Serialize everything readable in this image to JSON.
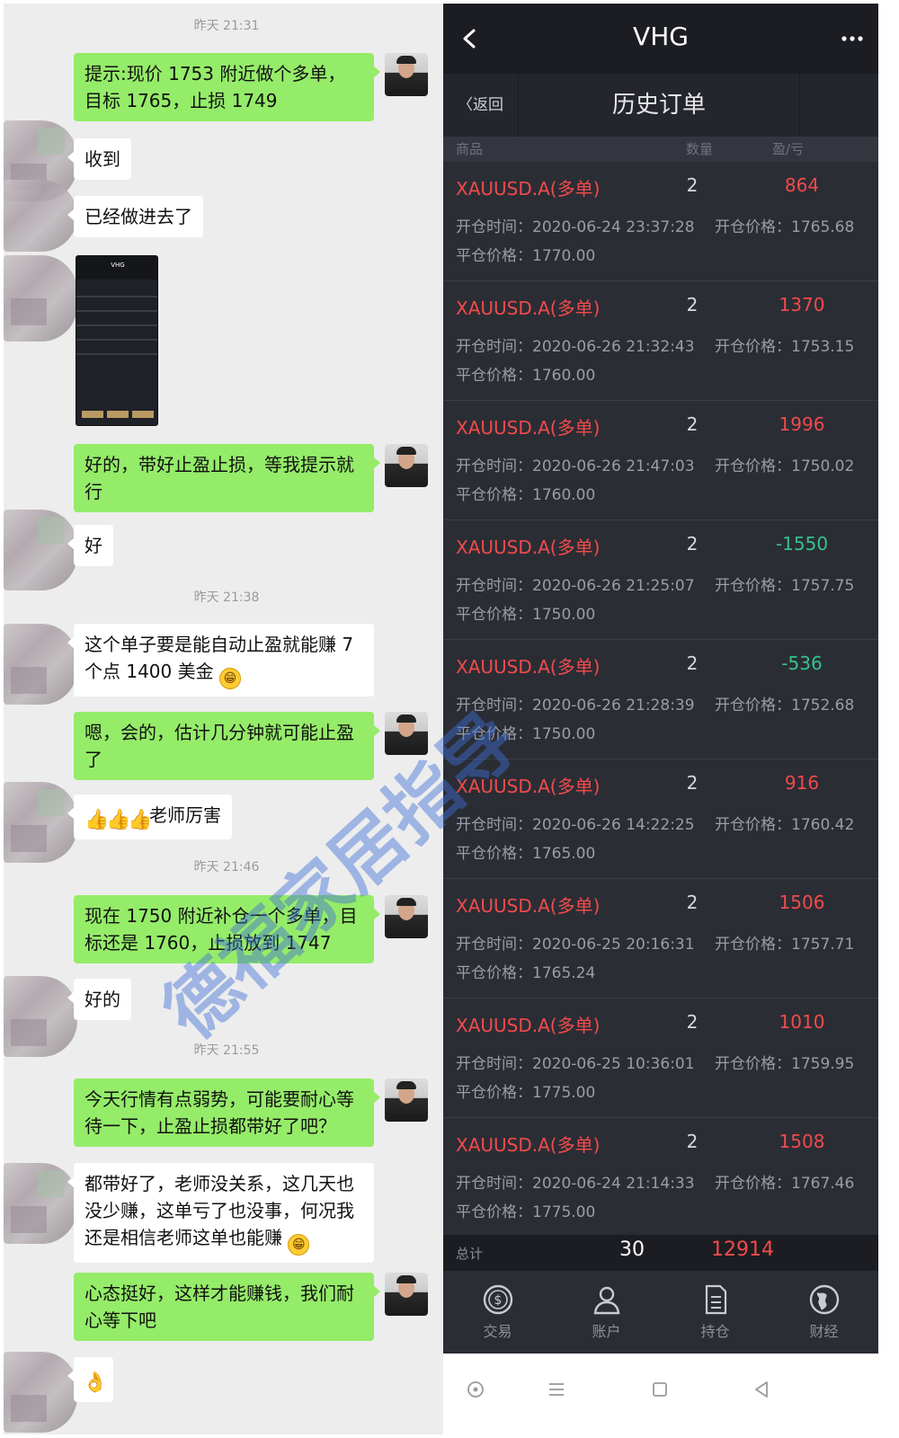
{
  "chat": {
    "timestamps": [
      "昨天 21:31",
      "昨天 21:38",
      "昨天 21:46",
      "昨天 21:55"
    ],
    "messages": [
      "提示:现价 1753 附近做个多单，目标 1765，止损 1749",
      "收到",
      "已经做进去了",
      "好的，带好止盈止损，等我提示就行",
      "好",
      "这个单子要是能自动止盈就能赚 7 个点 1400 美金",
      "嗯，会的，估计几分钟就可能止盈了",
      "老师厉害",
      "现在 1750 附近补仓一个多单，目标还是 1760，止损放到 1747",
      "好的",
      "今天行情有点弱势，可能要耐心等待一下，止盈止损都带好了吧？",
      "都带好了，老师没关系，这几天也没少赚，这单亏了也没事，何况我还是相信老师这单也能赚",
      "心态挺好，这样才能赚钱，我们耐心等下吧"
    ],
    "thumb_screenshot_title": "VHG"
  },
  "app": {
    "title": "VHG",
    "back_label": "〈返回",
    "sub_title": "历史订单",
    "columns": {
      "item": "商品",
      "qty": "数量",
      "pnl": "盈/亏"
    },
    "orders": [
      {
        "name": "XAUUSD.A(多单)",
        "qty": "2",
        "pnl": "864",
        "dir": "pos",
        "open_time": "开仓时间：2020-06-24 23:37:28",
        "open_price": "开仓价格：1765.68",
        "close_price": "平仓价格：1770.00"
      },
      {
        "name": "XAUUSD.A(多单)",
        "qty": "2",
        "pnl": "1370",
        "dir": "pos",
        "open_time": "开仓时间：2020-06-26 21:32:43",
        "open_price": "开仓价格：1753.15",
        "close_price": "平仓价格：1760.00"
      },
      {
        "name": "XAUUSD.A(多单)",
        "qty": "2",
        "pnl": "1996",
        "dir": "pos",
        "open_time": "开仓时间：2020-06-26 21:47:03",
        "open_price": "开仓价格：1750.02",
        "close_price": "平仓价格：1760.00"
      },
      {
        "name": "XAUUSD.A(多单)",
        "qty": "2",
        "pnl": "-1550",
        "dir": "neg",
        "open_time": "开仓时间：2020-06-26 21:25:07",
        "open_price": "开仓价格：1757.75",
        "close_price": "平仓价格：1750.00"
      },
      {
        "name": "XAUUSD.A(多单)",
        "qty": "2",
        "pnl": "-536",
        "dir": "neg",
        "open_time": "开仓时间：2020-06-26 21:28:39",
        "open_price": "开仓价格：1752.68",
        "close_price": "平仓价格：1750.00"
      },
      {
        "name": "XAUUSD.A(多单)",
        "qty": "2",
        "pnl": "916",
        "dir": "pos",
        "open_time": "开仓时间：2020-06-26 14:22:25",
        "open_price": "开仓价格：1760.42",
        "close_price": "平仓价格：1765.00"
      },
      {
        "name": "XAUUSD.A(多单)",
        "qty": "2",
        "pnl": "1506",
        "dir": "pos",
        "open_time": "开仓时间：2020-06-25 20:16:31",
        "open_price": "开仓价格：1757.71",
        "close_price": "平仓价格：1765.24"
      },
      {
        "name": "XAUUSD.A(多单)",
        "qty": "2",
        "pnl": "1010",
        "dir": "pos",
        "open_time": "开仓时间：2020-06-25 10:36:01",
        "open_price": "开仓价格：1759.95",
        "close_price": "平仓价格：1775.00"
      },
      {
        "name": "XAUUSD.A(多单)",
        "qty": "2",
        "pnl": "1508",
        "dir": "pos",
        "open_time": "开仓时间：2020-06-24 21:14:33",
        "open_price": "开仓价格：1767.46",
        "close_price": "平仓价格：1775.00"
      }
    ],
    "total": {
      "label": "总计",
      "qty": "30",
      "pnl": "12914"
    },
    "tabs": [
      {
        "label": "交易",
        "icon": "dollar-coin-icon"
      },
      {
        "label": "账户",
        "icon": "person-icon"
      },
      {
        "label": "持仓",
        "icon": "document-list-icon"
      },
      {
        "label": "财经",
        "icon": "globe-icon"
      }
    ]
  },
  "watermark": "德福家居指导",
  "colors": {
    "profit": "#f04b4b",
    "loss": "#36c28a",
    "my_bubble": "#95ec69",
    "app_bg": "#2b2d35"
  }
}
